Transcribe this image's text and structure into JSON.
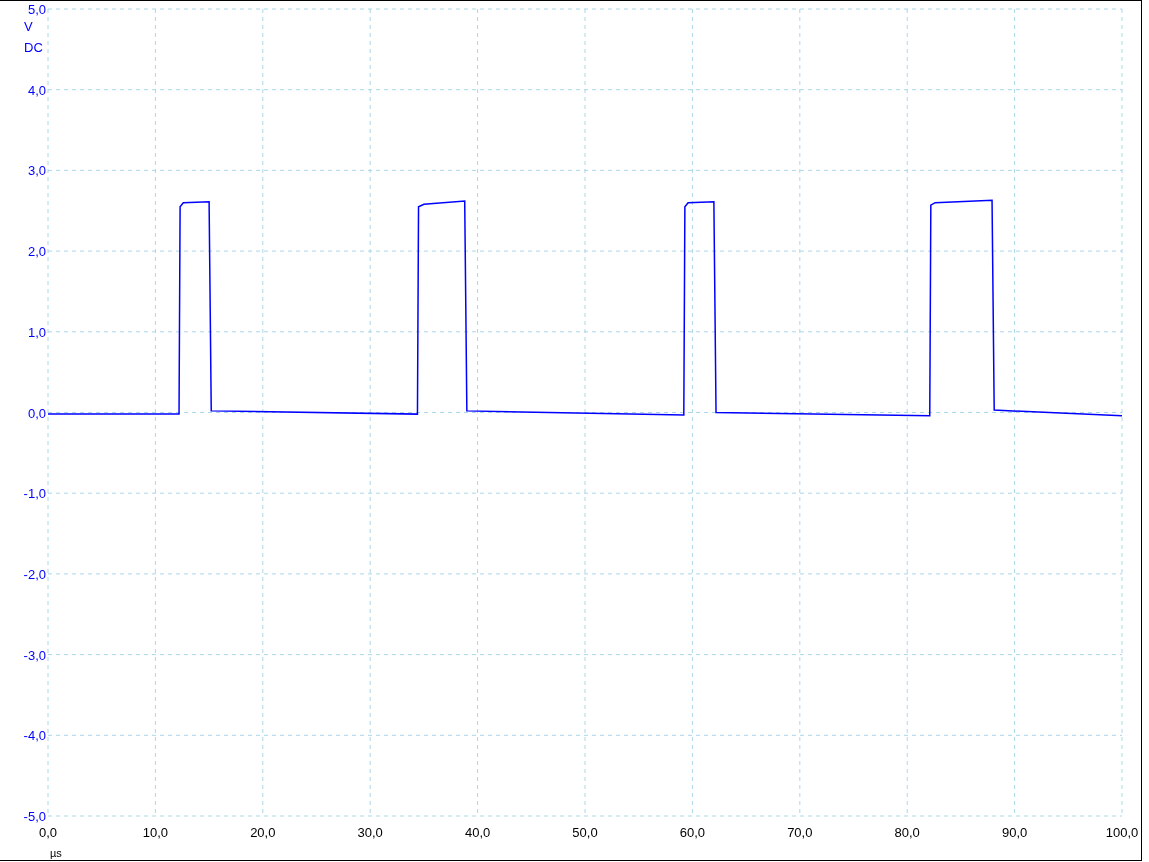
{
  "chart_data": {
    "type": "line",
    "grid": true,
    "xlabel": "µs",
    "ylabel": "V",
    "xlim": [
      0,
      100
    ],
    "ylim": [
      -5,
      5
    ],
    "xticks": [
      {
        "value": 0,
        "label": "0,0"
      },
      {
        "value": 10,
        "label": "10,0"
      },
      {
        "value": 20,
        "label": "20,0"
      },
      {
        "value": 30,
        "label": "30,0"
      },
      {
        "value": 40,
        "label": "40,0"
      },
      {
        "value": 50,
        "label": "50,0"
      },
      {
        "value": 60,
        "label": "60,0"
      },
      {
        "value": 70,
        "label": "70,0"
      },
      {
        "value": 80,
        "label": "80,0"
      },
      {
        "value": 90,
        "label": "90,0"
      },
      {
        "value": 100,
        "label": "100,0"
      }
    ],
    "yticks": [
      {
        "value": 5,
        "label": "5,0"
      },
      {
        "value": 4,
        "label": "4,0"
      },
      {
        "value": 3,
        "label": "3,0"
      },
      {
        "value": 2,
        "label": "2,0"
      },
      {
        "value": 1,
        "label": "1,0"
      },
      {
        "value": 0,
        "label": "0,0"
      },
      {
        "value": -1,
        "label": "-1,0"
      },
      {
        "value": -2,
        "label": "-2,0"
      },
      {
        "value": -3,
        "label": "-3,0"
      },
      {
        "value": -4,
        "label": "-4,0"
      },
      {
        "value": -5,
        "label": "-5,0"
      }
    ],
    "x": [
      0,
      12.2,
      12.3,
      12.6,
      15.0,
      15.2,
      34.4,
      34.5,
      35.0,
      38.8,
      39.0,
      59.2,
      59.3,
      59.6,
      62.0,
      62.2,
      82.1,
      82.2,
      82.6,
      87.9,
      88.1,
      100
    ],
    "series": [
      {
        "color": "#0000ff",
        "values": [
          -0.02,
          -0.02,
          2.55,
          2.6,
          2.61,
          0.02,
          -0.02,
          2.55,
          2.58,
          2.62,
          0.02,
          -0.03,
          2.55,
          2.6,
          2.61,
          0.0,
          -0.04,
          2.57,
          2.6,
          2.63,
          0.03,
          -0.04
        ]
      }
    ]
  },
  "coupling": "DC"
}
